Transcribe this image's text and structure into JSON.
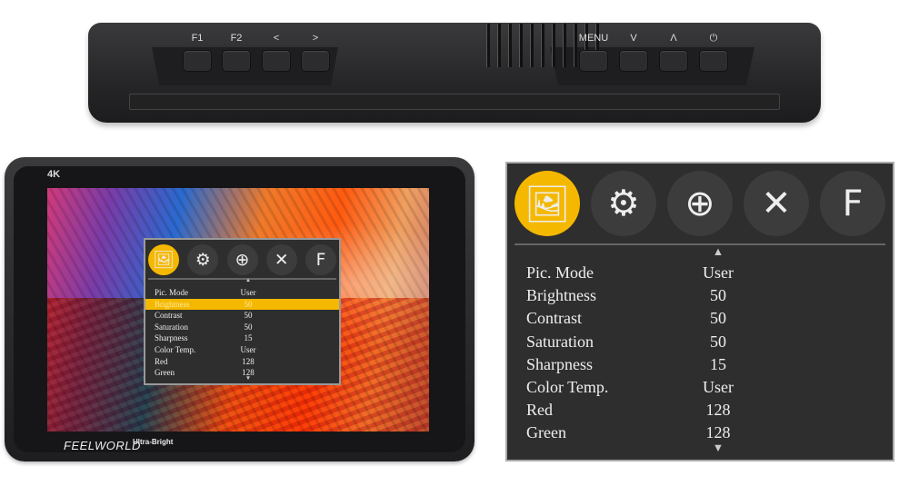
{
  "device": {
    "left_buttons": [
      "F1",
      "F2",
      "<",
      ">"
    ],
    "right_buttons": [
      "MENU",
      "V",
      "Λ",
      "⏻"
    ],
    "screen_label": "4K",
    "brand": "FEELWORLD",
    "tagline": "Ultra-Bright"
  },
  "osd": {
    "icons": [
      {
        "name": "picture-icon",
        "glyph": "🖼",
        "selected": true
      },
      {
        "name": "gears-icon",
        "glyph": "⚙",
        "selected": false
      },
      {
        "name": "zoom-icon",
        "glyph": "⊕",
        "selected": false
      },
      {
        "name": "tools-icon",
        "glyph": "✕",
        "selected": false
      },
      {
        "name": "function-icon",
        "glyph": "F",
        "selected": false
      }
    ],
    "up_arrow": "▲",
    "down_arrow": "▼",
    "items": [
      {
        "label": "Pic. Mode",
        "value": "User"
      },
      {
        "label": "Brightness",
        "value": "50"
      },
      {
        "label": "Contrast",
        "value": "50"
      },
      {
        "label": "Saturation",
        "value": "50"
      },
      {
        "label": "Sharpness",
        "value": "15"
      },
      {
        "label": "Color Temp.",
        "value": "User"
      },
      {
        "label": "Red",
        "value": "128"
      },
      {
        "label": "Green",
        "value": "128"
      }
    ],
    "selected_index_small": 1,
    "accent": "#f5b800"
  }
}
